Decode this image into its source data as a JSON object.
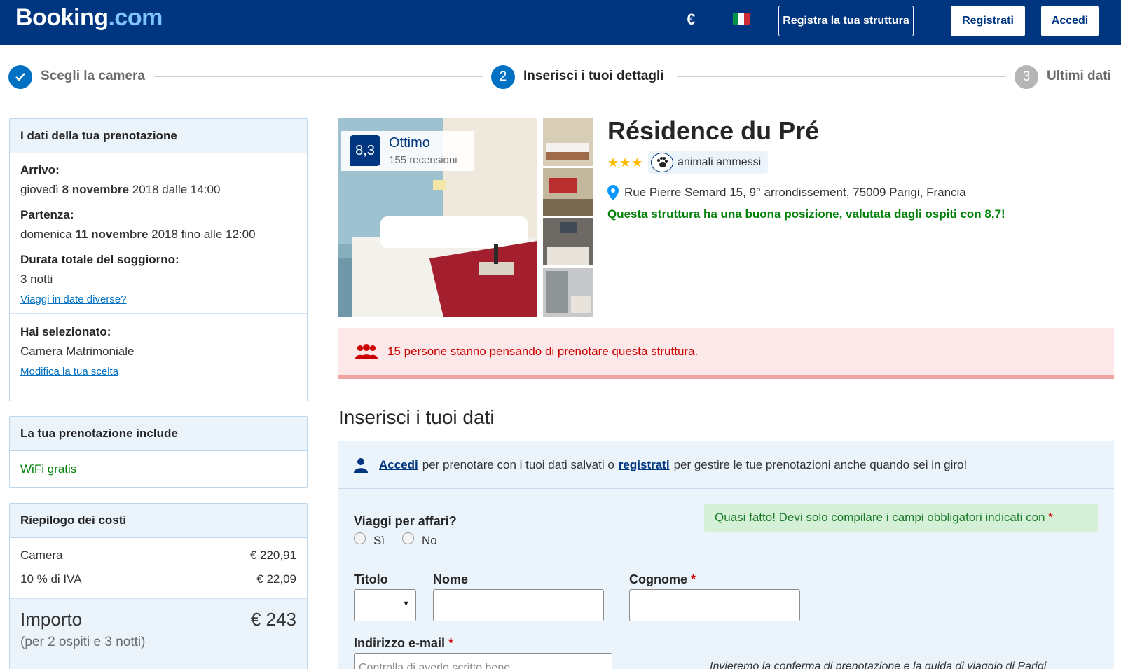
{
  "header": {
    "logo_main": "Booking",
    "logo_tld": ".com",
    "currency": "€",
    "register_property": "Registra la tua struttura",
    "register": "Registrati",
    "signin": "Accedi"
  },
  "progress": {
    "steps": [
      {
        "num": "",
        "label": "Scegli la camera",
        "state": "done"
      },
      {
        "num": "2",
        "label": "Inserisci i tuoi dettagli",
        "state": "current"
      },
      {
        "num": "3",
        "label": "Ultimi dati",
        "state": "upcoming"
      }
    ]
  },
  "booking": {
    "title": "I dati della tua prenotazione",
    "checkin_label": "Arrivo:",
    "checkin_day": "giovedì",
    "checkin_date": "8 novembre",
    "checkin_rest": "2018 dalle 14:00",
    "checkout_label": "Partenza:",
    "checkout_day": "domenica",
    "checkout_date": "11 novembre",
    "checkout_rest": "2018 fino alle 12:00",
    "duration_label": "Durata totale del soggiorno:",
    "duration_value": "3 notti",
    "change_dates": "Viaggi in date diverse?",
    "selected_label": "Hai selezionato:",
    "selected_value": "Camera Matrimoniale",
    "change_choice": "Modifica la tua scelta"
  },
  "includes": {
    "title": "La tua prenotazione include",
    "item": "WiFi gratis"
  },
  "costs": {
    "title": "Riepilogo dei costi",
    "rows": [
      {
        "label": "Camera",
        "amount": "€ 220,91"
      },
      {
        "label": "10 % di IVA",
        "amount": "€ 22,09"
      }
    ],
    "total_label": "Importo",
    "total_amount": "€ 243",
    "total_note": "(per 2 ospiti e 3 notti)"
  },
  "hotel": {
    "score": "8,3",
    "score_word": "Ottimo",
    "reviews": "155 recensioni",
    "name": "Résidence du Pré",
    "stars": "★★★",
    "star_count": 3,
    "pets": "animali ammessi",
    "address": "Rue Pierre Semard 15, 9° arrondissement, 75009 Parigi, Francia",
    "location_note": "Questa struttura ha una buona posizione, valutata dagli ospiti con 8,7!"
  },
  "alert": {
    "text": "15 persone stanno pensando di prenotare questa struttura."
  },
  "form": {
    "heading": "Inserisci i tuoi dati",
    "signin_link": "Accedi",
    "signin_mid": "per prenotare con i tuoi dati salvati o",
    "register_link": "registrati",
    "signin_end": "per gestire le tue prenotazioni anche quando sei in giro!",
    "business_label": "Viaggi per affari?",
    "yes": "Sì",
    "no": "No",
    "almost_done": "Quasi fatto! Devi solo compilare i campi obbligatori indicati con",
    "asterisk": "*",
    "title_label": "Titolo",
    "name_label": "Nome",
    "surname_label": "Cognome",
    "email_label": "Indirizzo e-mail",
    "email_placeholder": "Controlla di averlo scritto bene",
    "email_note": "Invieremo la conferma di prenotazione e la guida di viaggio di Parigi"
  },
  "colors": {
    "brand": "#003580",
    "accent": "#0071c2",
    "success": "#008009",
    "alert": "#cc0000",
    "star": "#febb02"
  }
}
